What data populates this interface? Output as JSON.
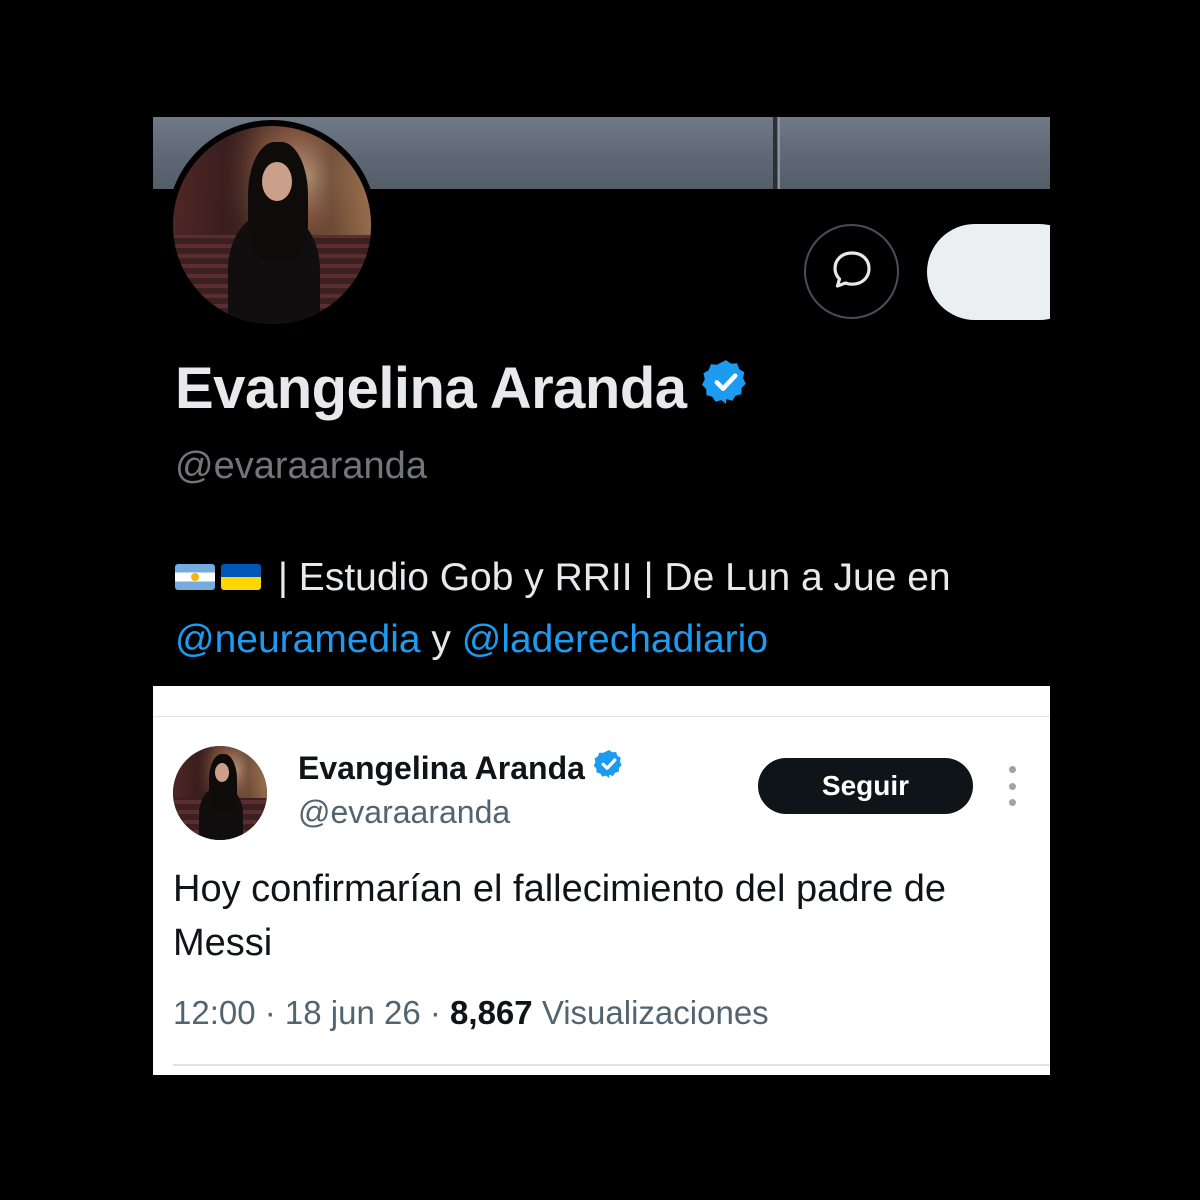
{
  "profile": {
    "display_name": "Evangelina Aranda",
    "handle": "@evaraaranda",
    "bio": {
      "flags": [
        "argentina-flag",
        "ukraine-flag"
      ],
      "text_1": " | Estudio Gob y RRII | De Lun a Jue en",
      "mention_1": "@neuramedia",
      "connector": " y ",
      "mention_2": "@laderechadiario"
    },
    "icons": {
      "message": "message-bubble-icon",
      "verified": "verified-badge-icon"
    }
  },
  "tweet": {
    "author_name": "Evangelina Aranda",
    "author_handle": "@evaraaranda",
    "follow_label": "Seguir",
    "text": "Hoy confirmarían el fallecimiento del padre de Messi",
    "time": "12:00",
    "sep": " · ",
    "date": "18 jun 26",
    "views_count": "8,867",
    "views_label": "Visualizaciones",
    "icons": {
      "more": "more-vertical-icon",
      "verified": "verified-badge-icon"
    }
  },
  "colors": {
    "accent_blue": "#1d9bf0",
    "verified_blue": "#1d9bf0",
    "dark_bg": "#000000",
    "text_light": "#e7e9ea",
    "text_muted": "#71767b",
    "button_dark": "#0f1419"
  }
}
